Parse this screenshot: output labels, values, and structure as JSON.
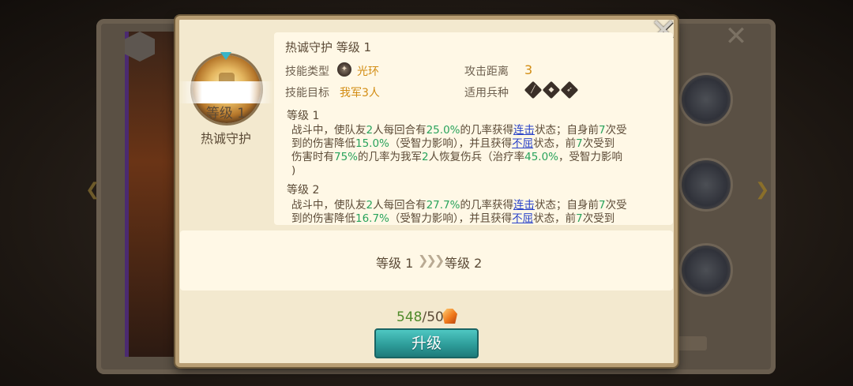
{
  "skill": {
    "name": "热诚守护",
    "title": "热诚守护 等级 1",
    "current_level_label": "等级 1"
  },
  "info": {
    "type_label": "技能类型",
    "type_value": "光环",
    "target_label": "技能目标",
    "target_value": "我军3人",
    "range_label": "攻击距离",
    "range_value": "3",
    "troop_label": "适用兵种"
  },
  "levels": [
    {
      "heading": "等级 1",
      "parts": [
        "战斗中，使队友",
        "2",
        "人每回合有",
        "25.0%",
        "的几率获得",
        "连击",
        "状态；自身前",
        "7",
        "次受",
        "到的伤害降低",
        "15.0%",
        "（受智力影响），并且获得",
        "不屈",
        "状态，前",
        "7",
        "次受到",
        "伤害时有",
        "75%",
        "的几率为我军",
        "2",
        "人恢复伤兵（治疗率",
        "45.0%",
        "，受智力影响",
        ")"
      ]
    },
    {
      "heading": "等级 2",
      "parts": [
        "战斗中，使队友",
        "2",
        "人每回合有",
        "27.7%",
        "的几率获得",
        "连击",
        "状态；自身前",
        "7",
        "次受",
        "到的伤害降低",
        "16.7%",
        "（受智力影响），并且获得",
        "不屈",
        "状态，前",
        "7",
        "次受到"
      ]
    }
  ],
  "upgrade": {
    "from": "等级 1",
    "to": "等级 2",
    "cost_have": "548",
    "cost_sep": "/",
    "cost_need": "50",
    "button_label": "升级"
  },
  "icons": {
    "close": "close-icon",
    "gem": "gem-icon",
    "skill_type": "halo-icon",
    "troops": [
      "spear-troop-icon",
      "shield-troop-icon",
      "bow-troop-icon"
    ]
  },
  "colors": {
    "highlight_green": "#28a35b",
    "keyword_blue": "#2741c8",
    "button_teal": "#2e9d9a",
    "panel_cream": "#fff8e6"
  }
}
